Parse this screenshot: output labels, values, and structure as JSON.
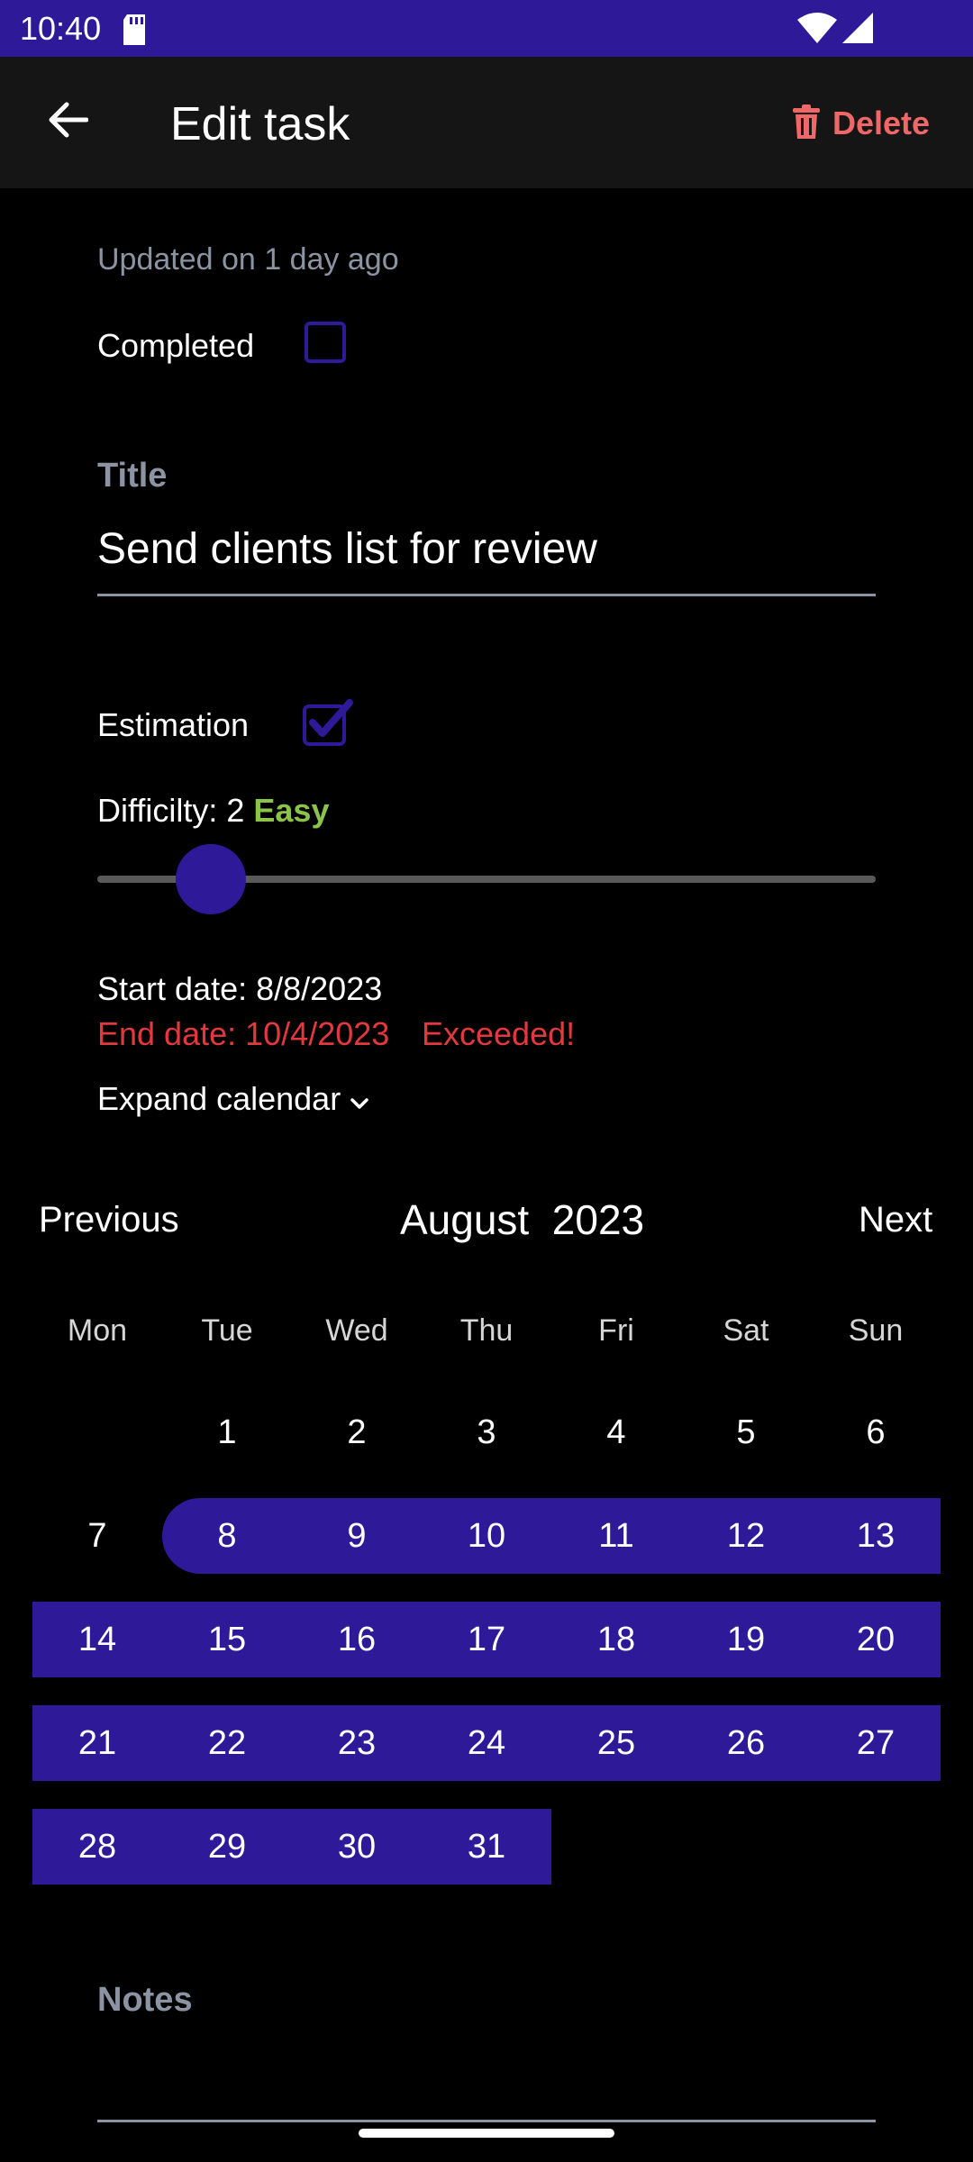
{
  "status_bar": {
    "time": "10:40"
  },
  "app_bar": {
    "title": "Edit task",
    "delete_label": "Delete"
  },
  "form": {
    "updated_text": "Updated on 1 day ago",
    "completed_label": "Completed",
    "completed_checked": false,
    "title_label": "Title",
    "title_value": "Send clients list for review",
    "estimation_label": "Estimation",
    "estimation_checked": true,
    "difficulty_prefix": "Difficilty: 2",
    "difficulty_level": "Easy",
    "difficulty_value": 2,
    "start_date": "Start date: 8/8/2023",
    "end_date": "End date: 10/4/2023",
    "exceeded": "Exceeded!",
    "expand_calendar": "Expand calendar",
    "notes_label": "Notes"
  },
  "calendar": {
    "previous": "Previous",
    "next": "Next",
    "month": "August",
    "year": "2023",
    "weekdays": [
      "Mon",
      "Tue",
      "Wed",
      "Thu",
      "Fri",
      "Sat",
      "Sun"
    ],
    "first_weekday_offset": 1,
    "days_in_month": 31,
    "range_start_day": 8,
    "range_end_day": 31
  },
  "colors": {
    "accent": "#2e1a98",
    "danger": "#e3383d",
    "delete": "#f06767",
    "easy": "#8cc34a",
    "muted": "#8c94a3"
  }
}
